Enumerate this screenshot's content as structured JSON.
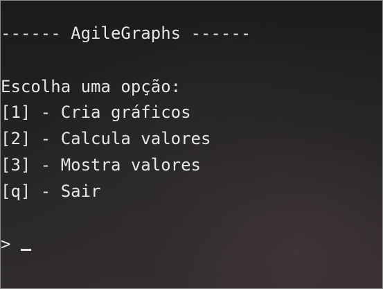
{
  "header": {
    "title": "------ AgileGraphs ------"
  },
  "menu": {
    "prompt": "Escolha uma opção:",
    "options": [
      {
        "label": "[1] - Cria gráficos"
      },
      {
        "label": "[2] - Calcula valores"
      },
      {
        "label": "[3] - Mostra valores"
      },
      {
        "label": "[q] - Sair"
      }
    ]
  },
  "input": {
    "prompt_symbol": "> "
  }
}
